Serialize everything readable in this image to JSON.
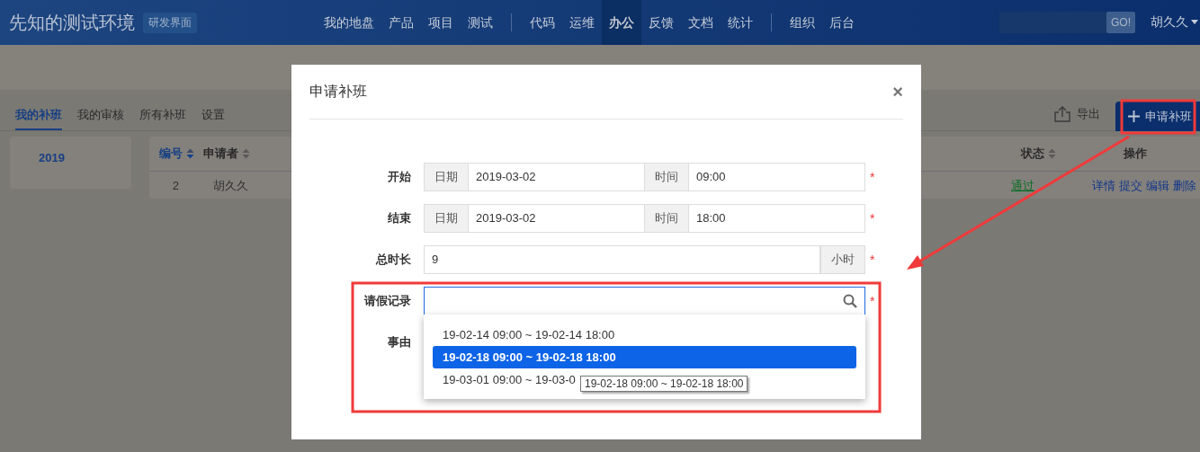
{
  "header": {
    "title": "先知的测试环境",
    "badge": "研发界面",
    "nav_groups": [
      [
        {
          "label": "我的地盘",
          "selected": false
        },
        {
          "label": "产品",
          "selected": false
        },
        {
          "label": "项目",
          "selected": false
        },
        {
          "label": "测试",
          "selected": false
        }
      ],
      [
        {
          "label": "代码",
          "selected": false
        },
        {
          "label": "运维",
          "selected": false
        },
        {
          "label": "办公",
          "selected": true
        },
        {
          "label": "反馈",
          "selected": false
        },
        {
          "label": "文档",
          "selected": false
        },
        {
          "label": "统计",
          "selected": false
        }
      ],
      [
        {
          "label": "组织",
          "selected": false
        },
        {
          "label": "后台",
          "selected": false
        }
      ]
    ],
    "search_button": "GO!",
    "user": "胡久久"
  },
  "tabs": [
    {
      "label": "我的补班",
      "selected": true
    },
    {
      "label": "我的审核",
      "selected": false
    },
    {
      "label": "所有补班",
      "selected": false
    },
    {
      "label": "设置",
      "selected": false
    }
  ],
  "export_button": "导出",
  "apply_button": "申请补班",
  "years": [
    {
      "label": "2019",
      "selected": true
    }
  ],
  "table": {
    "columns": [
      {
        "label": "编号",
        "sorted": true
      },
      {
        "label": "申请者",
        "sorted": false
      },
      {
        "label": "状态",
        "sorted": false
      },
      {
        "label": "操作",
        "kind": "plain"
      }
    ],
    "rows": [
      {
        "id": "2",
        "applicant": "胡久久",
        "status": "通过",
        "actions": [
          "详情",
          "提交",
          "编辑",
          "删除"
        ]
      }
    ]
  },
  "modal": {
    "title": "申请补班",
    "close": "×",
    "fields": [
      {
        "kind": "datetime",
        "label": "开始",
        "date_addon": "日期",
        "date": "2019-03-02",
        "time_addon": "时间",
        "time": "09:00",
        "required_mark": "*"
      },
      {
        "kind": "datetime",
        "label": "结束",
        "date_addon": "日期",
        "date": "2019-03-02",
        "time_addon": "时间",
        "time": "18:00",
        "required_mark": "*"
      },
      {
        "kind": "unit",
        "label": "总时长",
        "value": "9",
        "unit": "小时",
        "required_mark": "*"
      },
      {
        "kind": "search",
        "label": "请假记录",
        "focused": true,
        "required_mark": "*"
      },
      {
        "kind": "textarea",
        "label": "事由"
      }
    ],
    "dropdown": [
      {
        "text": "19-02-14 09:00 ~ 19-02-14 18:00",
        "selected": false
      },
      {
        "text": "19-02-18 09:00 ~ 19-02-18 18:00",
        "selected": true
      },
      {
        "text": "19-03-01 09:00 ~ 19-03-0",
        "selected": false
      }
    ],
    "tooltip": "19-02-18 09:00 ~ 19-02-18 18:00"
  }
}
